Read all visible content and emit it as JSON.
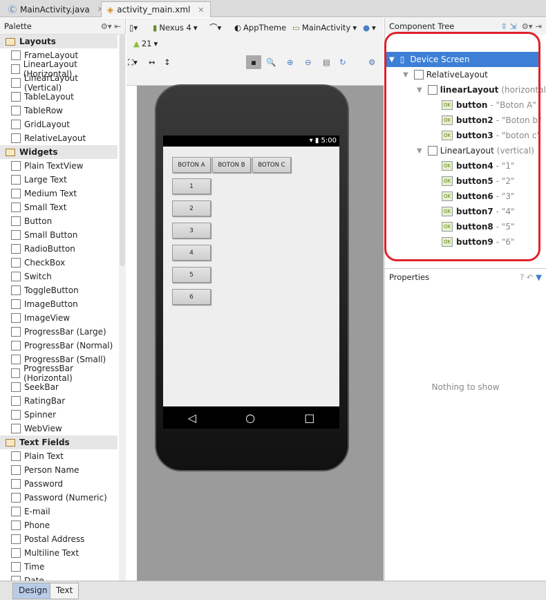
{
  "tabs": [
    {
      "label": "MainActivity.java",
      "icon": "java-class-icon"
    },
    {
      "label": "activity_main.xml",
      "icon": "xml-file-icon",
      "active": true
    }
  ],
  "palette": {
    "title": "Palette",
    "groups": [
      {
        "label": "Layouts",
        "items": [
          "FrameLayout",
          "LinearLayout (Horizontal)",
          "LinearLayout (Vertical)",
          "TableLayout",
          "TableRow",
          "GridLayout",
          "RelativeLayout"
        ]
      },
      {
        "label": "Widgets",
        "items": [
          "Plain TextView",
          "Large Text",
          "Medium Text",
          "Small Text",
          "Button",
          "Small Button",
          "RadioButton",
          "CheckBox",
          "Switch",
          "ToggleButton",
          "ImageButton",
          "ImageView",
          "ProgressBar (Large)",
          "ProgressBar (Normal)",
          "ProgressBar (Small)",
          "ProgressBar (Horizontal)",
          "SeekBar",
          "RatingBar",
          "Spinner",
          "WebView"
        ]
      },
      {
        "label": "Text Fields",
        "items": [
          "Plain Text",
          "Person Name",
          "Password",
          "Password (Numeric)",
          "E-mail",
          "Phone",
          "Postal Address",
          "Multiline Text",
          "Time",
          "Date"
        ]
      }
    ]
  },
  "toolbar": {
    "device": "Nexus 4",
    "theme": "AppTheme",
    "activity": "MainActivity",
    "api": "21"
  },
  "device": {
    "time": "5:00",
    "row_buttons": [
      "BOTON A",
      "BOTON B",
      "BOTON C"
    ],
    "col_buttons": [
      "1",
      "2",
      "3",
      "4",
      "5",
      "6"
    ]
  },
  "component_tree": {
    "title": "Component Tree",
    "nodes": [
      {
        "name": "Device Screen",
        "detail": "",
        "level": 0,
        "selected": true
      },
      {
        "name": "RelativeLayout",
        "detail": "",
        "level": 1
      },
      {
        "name": "linearLayout",
        "detail": "(horizontal)",
        "level": 2,
        "bold": true
      },
      {
        "name": "button",
        "detail": "- \"Boton A\"",
        "level": 3,
        "bold": true
      },
      {
        "name": "button2",
        "detail": "- \"Boton b\"",
        "level": 3,
        "bold": true
      },
      {
        "name": "button3",
        "detail": "- \"boton c\"",
        "level": 3,
        "bold": true
      },
      {
        "name": "LinearLayout",
        "detail": "(vertical)",
        "level": 2
      },
      {
        "name": "button4",
        "detail": "- \"1\"",
        "level": 3,
        "bold": true
      },
      {
        "name": "button5",
        "detail": "- \"2\"",
        "level": 3,
        "bold": true
      },
      {
        "name": "button6",
        "detail": "- \"3\"",
        "level": 3,
        "bold": true
      },
      {
        "name": "button7",
        "detail": "- \"4\"",
        "level": 3,
        "bold": true
      },
      {
        "name": "button8",
        "detail": "- \"5\"",
        "level": 3,
        "bold": true
      },
      {
        "name": "button9",
        "detail": "- \"6\"",
        "level": 3,
        "bold": true
      }
    ]
  },
  "properties": {
    "title": "Properties",
    "empty": "Nothing to show"
  },
  "bottom_tabs": [
    "Design",
    "Text"
  ],
  "colors": {
    "selection": "#3d7fd6",
    "highlight": "#e0202a"
  }
}
